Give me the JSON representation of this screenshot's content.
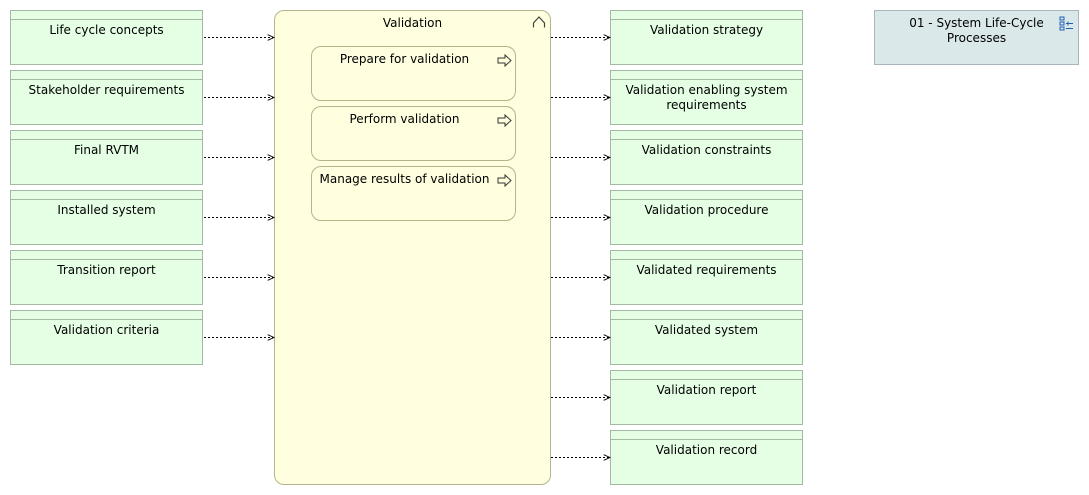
{
  "inputs": [
    {
      "label": "Life cycle concepts"
    },
    {
      "label": "Stakeholder requirements"
    },
    {
      "label": "Final RVTM"
    },
    {
      "label": "Installed system"
    },
    {
      "label": "Transition report"
    },
    {
      "label": "Validation criteria"
    }
  ],
  "process": {
    "title": "Validation",
    "subprocesses": [
      {
        "label": "Prepare for validation"
      },
      {
        "label": "Perform validation"
      },
      {
        "label": "Manage results of validation"
      }
    ]
  },
  "outputs": [
    {
      "label": "Validation strategy"
    },
    {
      "label": "Validation enabling system requirements"
    },
    {
      "label": "Validation constraints"
    },
    {
      "label": "Validation procedure"
    },
    {
      "label": "Validated requirements"
    },
    {
      "label": "Validated system"
    },
    {
      "label": "Validation report"
    },
    {
      "label": "Validation record"
    }
  ],
  "reference": {
    "label": "01 - System Life-Cycle Processes"
  },
  "colors": {
    "object_fill": "#e5ffe5",
    "process_fill": "#ffffe0",
    "reference_fill": "#dbe8ea"
  }
}
